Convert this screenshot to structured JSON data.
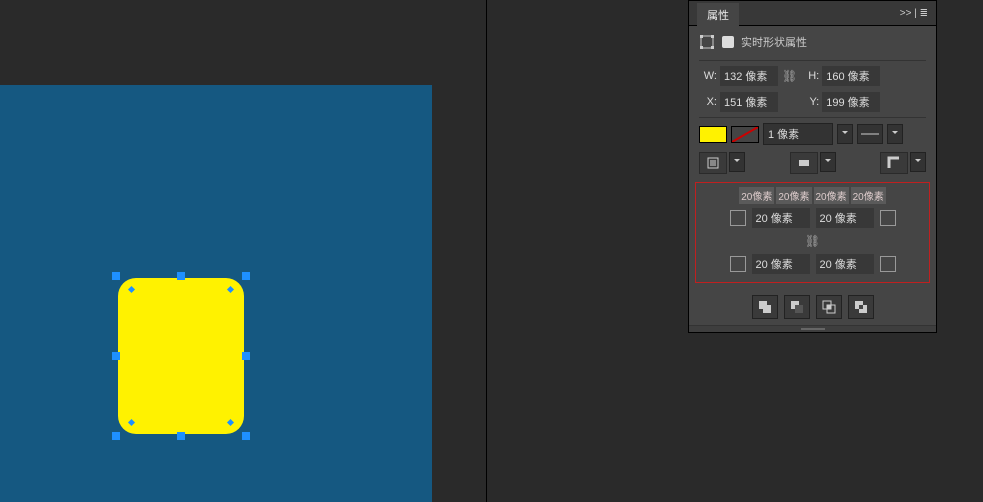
{
  "panel": {
    "title": "属性",
    "flyout": ">> | ≣",
    "header": "实时形状属性"
  },
  "dims": {
    "wLabel": "W:",
    "w": "132 像素",
    "hLabel": "H:",
    "h": "160 像素",
    "xLabel": "X:",
    "x": "151 像素",
    "yLabel": "Y:",
    "y": "199 像素",
    "link": "⛓"
  },
  "style": {
    "fill": "#fff200",
    "strokeWidth": "1 像素"
  },
  "corners": {
    "tip": [
      "20像素",
      "20像素",
      "20像素",
      "20像素"
    ],
    "tl": "20 像素",
    "tr": "20 像素",
    "bl": "20 像素",
    "br": "20 像素",
    "link": "⛓"
  },
  "canvas": {
    "bg": "#155881"
  }
}
